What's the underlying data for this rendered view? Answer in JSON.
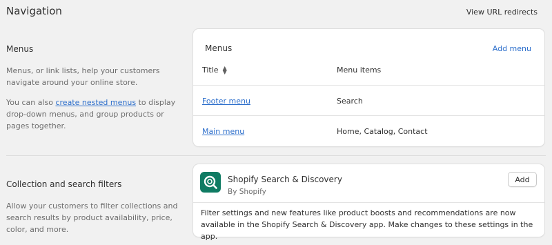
{
  "page": {
    "title": "Navigation",
    "view_redirects_label": "View URL redirects"
  },
  "menus_section": {
    "heading": "Menus",
    "description": "Menus, or link lists, help your customers navigate around your online store.",
    "nested_prefix": "You can also ",
    "nested_link": "create nested menus",
    "nested_suffix": " to display drop-down menus, and group products or pages together."
  },
  "menus_card": {
    "title": "Menus",
    "add_label": "Add menu",
    "columns": {
      "title": "Title",
      "items": "Menu items"
    },
    "rows": [
      {
        "title": "Footer menu",
        "items": "Search"
      },
      {
        "title": "Main menu",
        "items": "Home, Catalog, Contact"
      }
    ]
  },
  "filters_section": {
    "heading": "Collection and search filters",
    "description": "Allow your customers to filter collections and search results by product availability, price, color, and more."
  },
  "app_card": {
    "name": "Shopify Search & Discovery",
    "by": "By Shopify",
    "add_label": "Add",
    "icon": "search-discovery-icon",
    "icon_color": "#0f7b63",
    "description": "Filter settings and new features like product boosts and recommendations are now available in the Shopify Search & Discovery app. Make changes to these settings in the app."
  },
  "colors": {
    "background": "#f1f1f1",
    "link": "#2c6ecb",
    "text": "#303030",
    "subdued_text": "#6d6d6d"
  }
}
